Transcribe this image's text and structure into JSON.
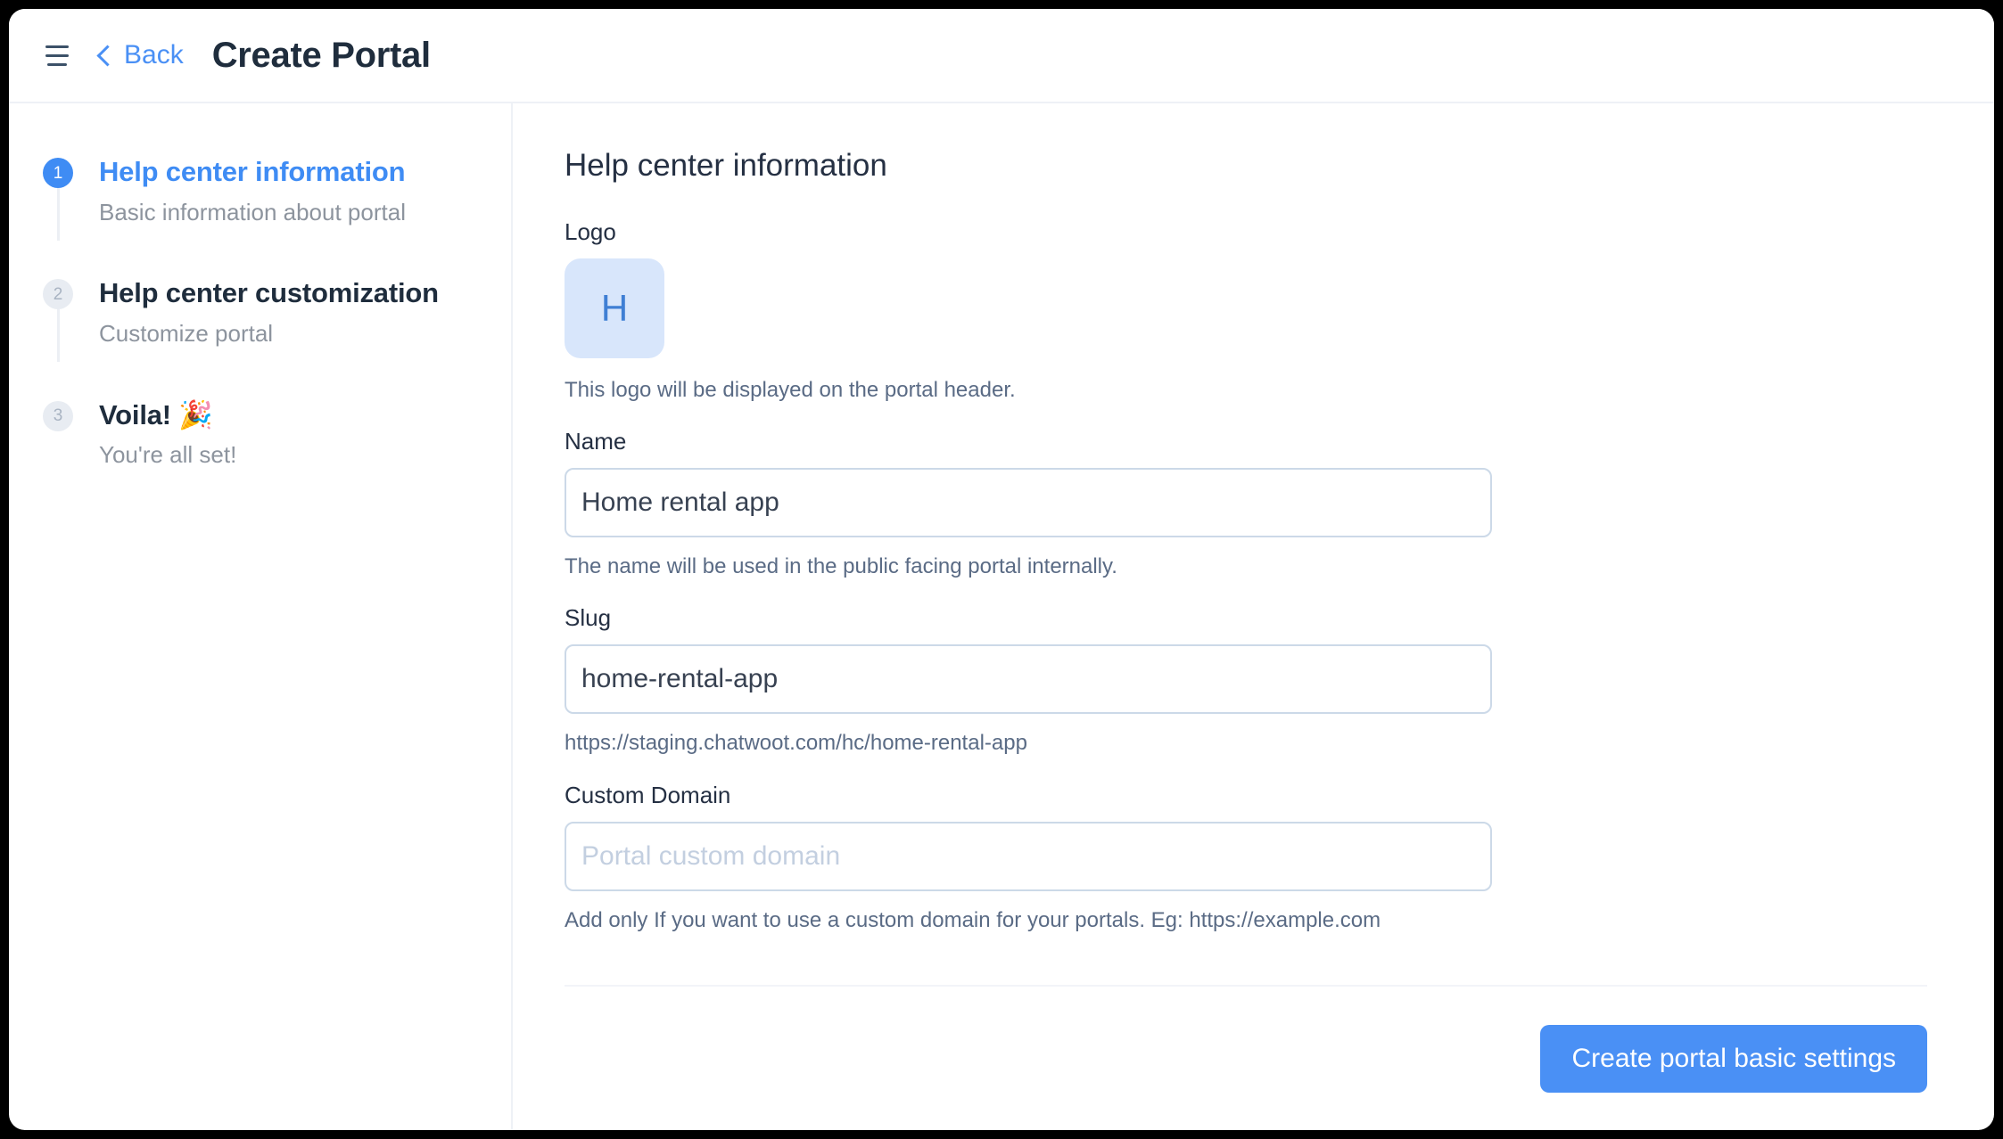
{
  "header": {
    "menu_icon": "hamburger-menu-icon",
    "back_label": "Back",
    "back_icon": "chevron-left-icon",
    "title": "Create Portal"
  },
  "stepper": {
    "steps": [
      {
        "number": "1",
        "title": "Help center information",
        "subtitle": "Basic information about portal",
        "state": "active"
      },
      {
        "number": "2",
        "title": "Help center customization",
        "subtitle": "Customize portal",
        "state": "inactive"
      },
      {
        "number": "3",
        "title": "Voila! 🎉",
        "subtitle": "You're all set!",
        "state": "inactive"
      }
    ]
  },
  "main": {
    "section_heading": "Help center information",
    "logo": {
      "label": "Logo",
      "initial": "H",
      "hint": "This logo will be displayed on the portal header."
    },
    "name": {
      "label": "Name",
      "value": "Home rental app",
      "placeholder": "",
      "hint": "The name will be used in the public facing portal internally."
    },
    "slug": {
      "label": "Slug",
      "value": "home-rental-app",
      "placeholder": "",
      "hint": "https://staging.chatwoot.com/hc/home-rental-app"
    },
    "custom_domain": {
      "label": "Custom Domain",
      "value": "",
      "placeholder": "Portal custom domain",
      "hint": "Add only If you want to use a custom domain for your portals. Eg: https://example.com"
    },
    "submit_label": "Create portal basic settings"
  },
  "colors": {
    "accent": "#4a90f5",
    "step_active": "#3f8cf4",
    "logo_bg": "#d8e6fb",
    "logo_fg": "#3f7fd4",
    "heading": "#1f2d3d",
    "muted": "#8d949e"
  }
}
